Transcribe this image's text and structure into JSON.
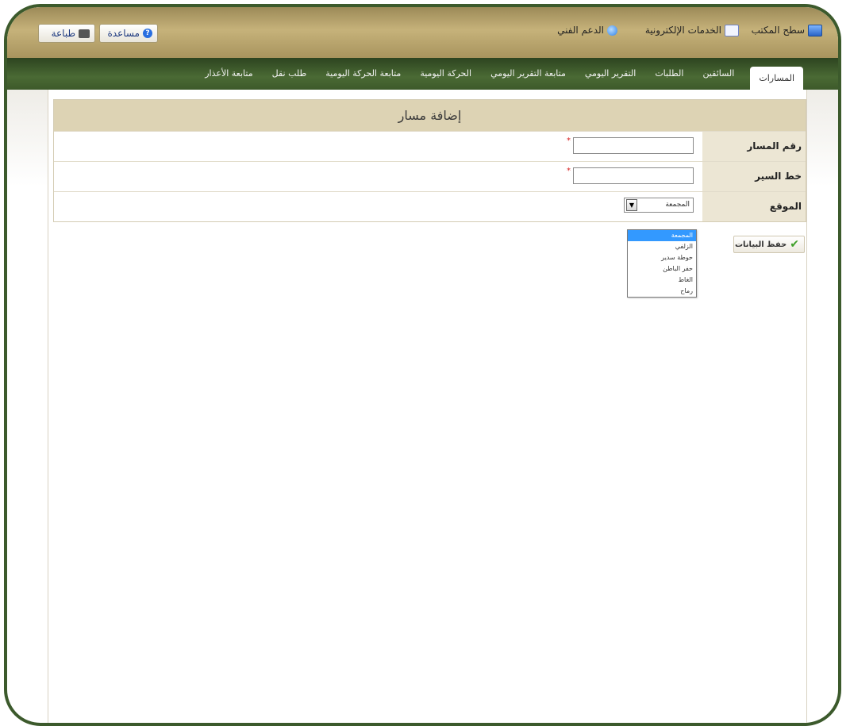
{
  "header": {
    "links": [
      {
        "label": "سطح المكتب",
        "icon": "desktop-icon"
      },
      {
        "label": "الخدمات الإلكترونية",
        "icon": "eservices-icon"
      },
      {
        "label": "الدعم الفني",
        "icon": "support-icon"
      }
    ],
    "help_label": "مساعدة",
    "print_label": "طباعة"
  },
  "tabs": [
    {
      "label": "المسارات",
      "active": true
    },
    {
      "label": "السائقين"
    },
    {
      "label": "الطلبات"
    },
    {
      "label": "التقرير اليومي"
    },
    {
      "label": "متابعة التقرير اليومي"
    },
    {
      "label": "الحركة اليومية"
    },
    {
      "label": "متابعة الحركة اليومية"
    },
    {
      "label": "طلب نقل"
    },
    {
      "label": "متابعة الأعذار"
    }
  ],
  "form": {
    "title": "إضافة مسار",
    "fields": {
      "route_number": {
        "label": "رقم المسار",
        "value": "",
        "required_mark": "*"
      },
      "route_line": {
        "label": "خط السير",
        "value": "",
        "required_mark": "*"
      },
      "location": {
        "label": "الموقع",
        "selected": "المجمعة"
      }
    },
    "location_options": [
      "المجمعة",
      "الزلفي",
      "حوطة سدير",
      "حفر الباطن",
      "الغاط",
      "رماح"
    ],
    "save_label": "حفظ البيانات"
  },
  "colors": {
    "topbar": "#b19f68",
    "tabbar": "#3d5a2a",
    "frame": "#3c5a2c",
    "form_header": "#ddd3b4",
    "label_cell": "#ece6d4",
    "dropdown_selected": "#3399ff"
  }
}
